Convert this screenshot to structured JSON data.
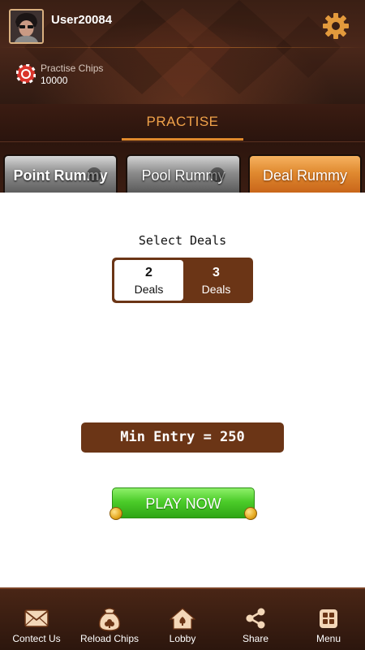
{
  "header": {
    "username": "User20084",
    "chips_label": "Practise Chips",
    "chips_value": "10000"
  },
  "mode": {
    "title": "PRACTISE"
  },
  "tabs": [
    {
      "label": "Point Rummy",
      "state": "inactive"
    },
    {
      "label": "Pool Rummy",
      "state": "inactive"
    },
    {
      "label": "Deal Rummy",
      "state": "active"
    }
  ],
  "main": {
    "select_title": "Select Deals",
    "deal_options": [
      {
        "number": "2",
        "text": "Deals",
        "selected": true
      },
      {
        "number": "3",
        "text": "Deals",
        "selected": false
      }
    ],
    "min_entry": "Min Entry = 250",
    "play_label": "PLAY NOW"
  },
  "bottom_nav": [
    {
      "label": "Contect Us",
      "icon": "mail-icon"
    },
    {
      "label": "Reload Chips",
      "icon": "chip-bag-icon"
    },
    {
      "label": "Lobby",
      "icon": "home-icon"
    },
    {
      "label": "Share",
      "icon": "share-icon"
    },
    {
      "label": "Menu",
      "icon": "menu-grid-icon"
    }
  ],
  "colors": {
    "header_brown": "#3a1f14",
    "accent_orange": "#e0892c",
    "panel_brown": "#6b3516",
    "play_green": "#4ccc2a"
  }
}
